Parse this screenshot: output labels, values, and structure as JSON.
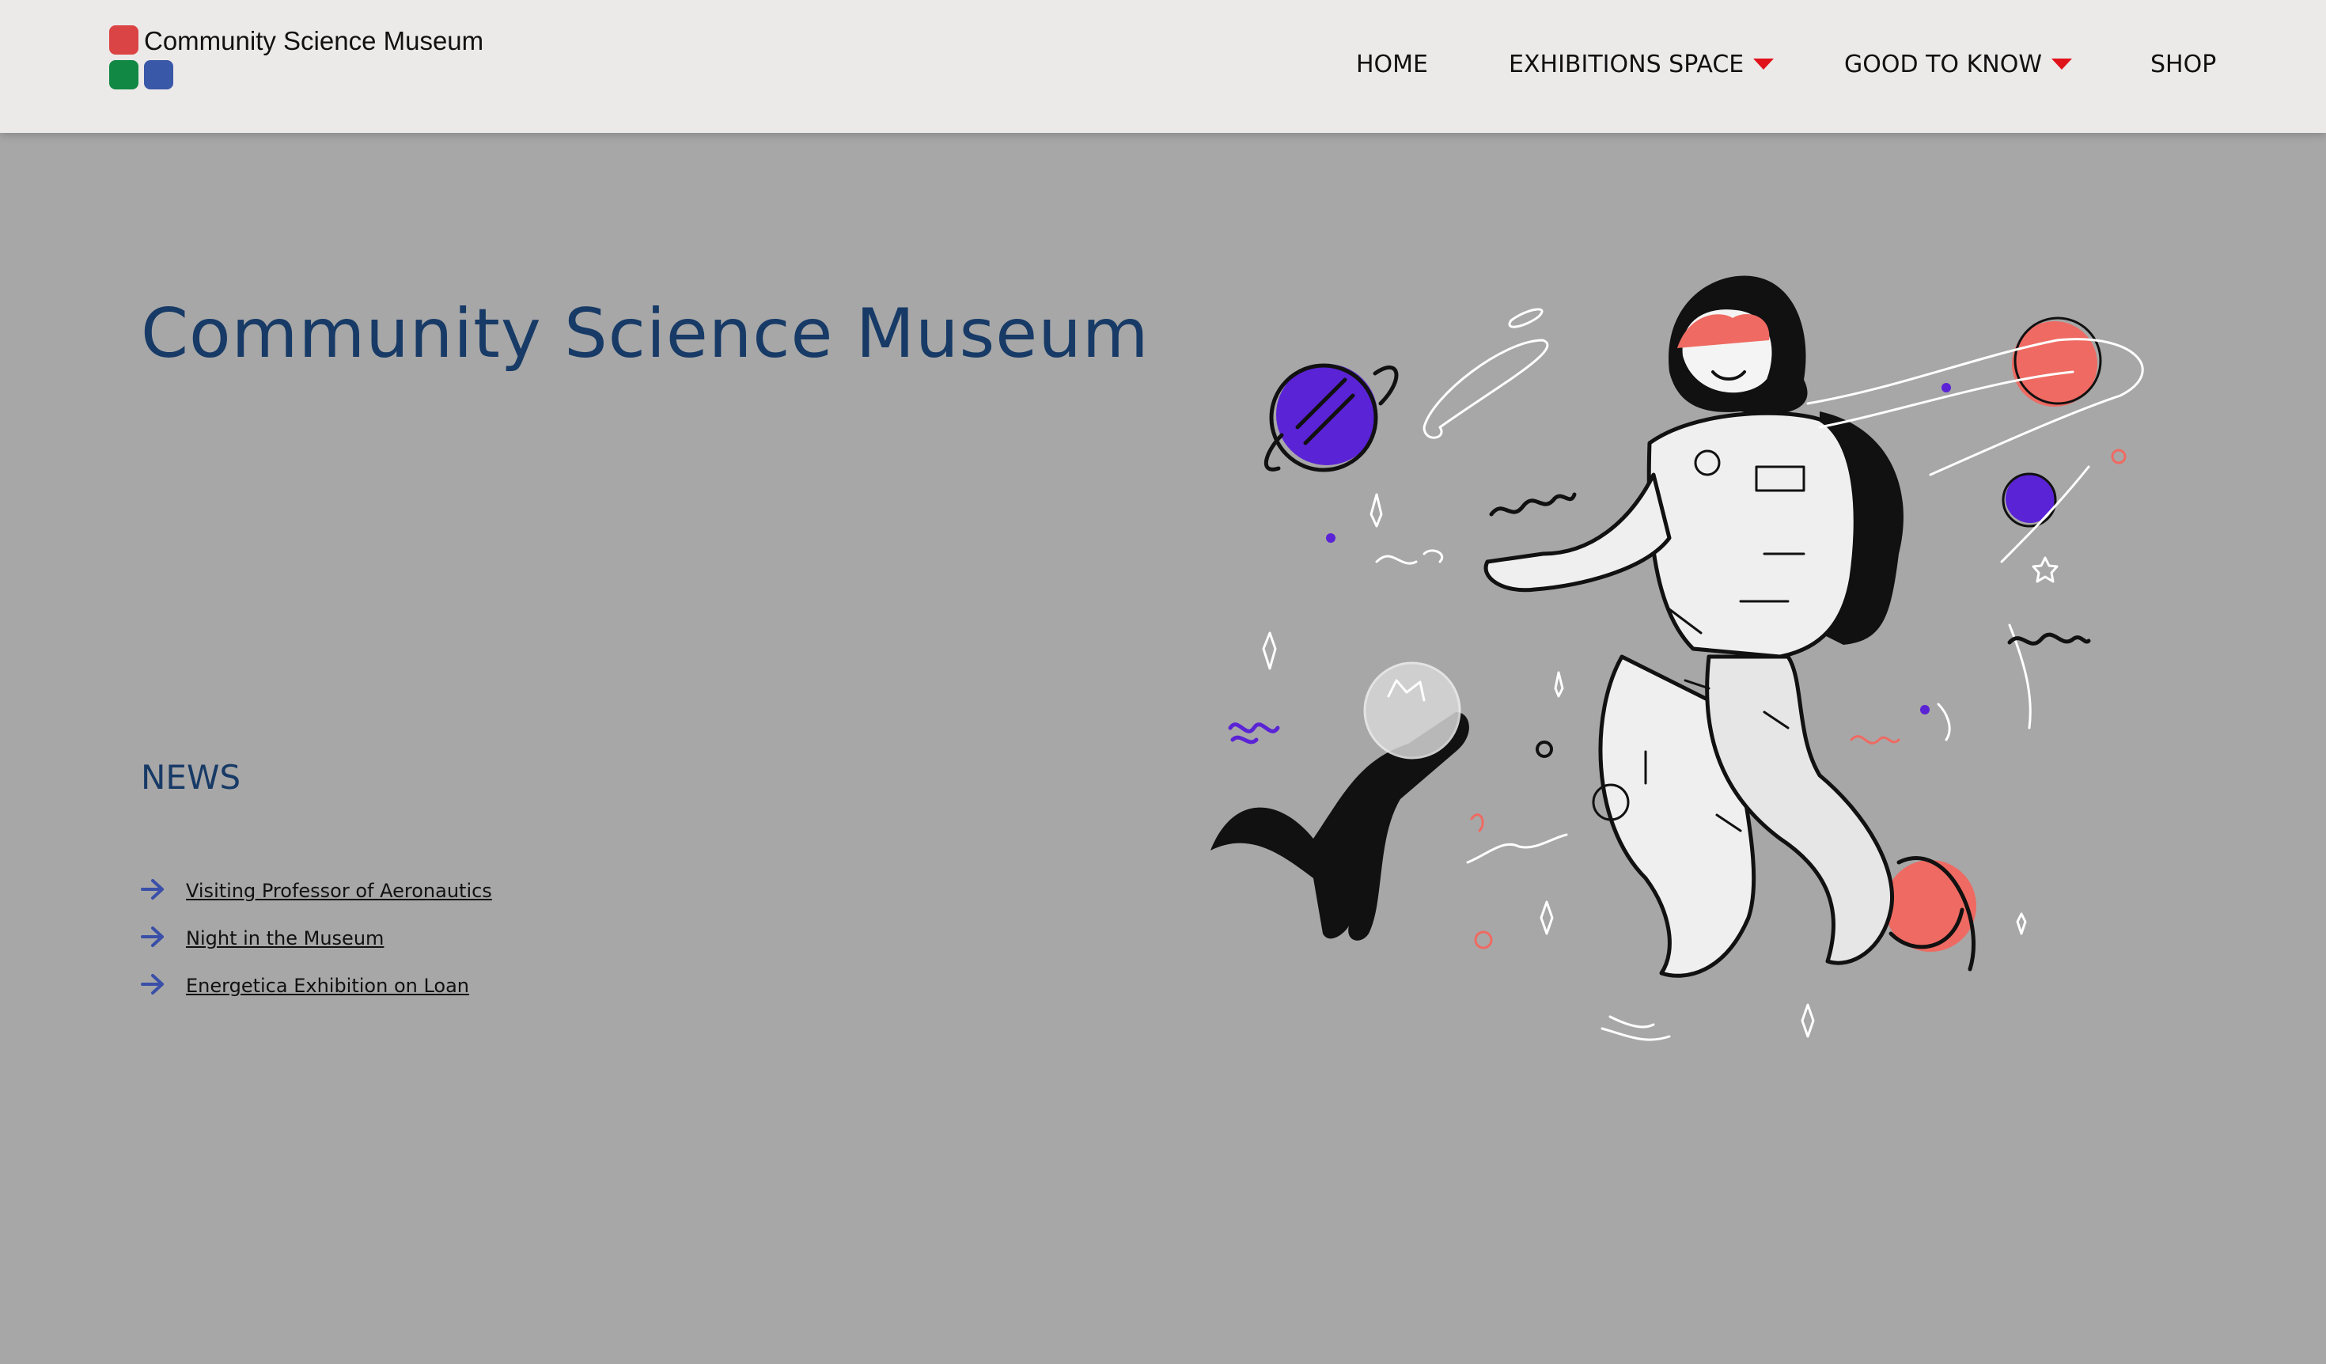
{
  "header": {
    "logo_text": "Community Science Museum",
    "nav": {
      "home": "HOME",
      "exhibitions": "EXHIBITIONS SPACE",
      "good_to_know": "GOOD TO KNOW",
      "shop": "SHOP"
    }
  },
  "hero": {
    "title": "Community Science Museum"
  },
  "news": {
    "heading": "NEWS",
    "items": [
      "Visiting Professor of Aeronautics",
      "Night in the Museum",
      "Energetica Exhibition on Loan"
    ]
  },
  "colors": {
    "background": "#a7a7a7",
    "header": "#ece9e9",
    "title": "#173a66",
    "caret": "#e0131b",
    "arrow": "#3a4fa8",
    "planet_purple": "#5b23d6",
    "planet_coral": "#ef6a62",
    "logo_red": "#db4444",
    "logo_green": "#118844",
    "logo_blue": "#3a58a8"
  },
  "icons": [
    "caret-down-icon",
    "arrow-right-icon",
    "astronaut-illustration",
    "cat-illustration",
    "planet-icon"
  ]
}
